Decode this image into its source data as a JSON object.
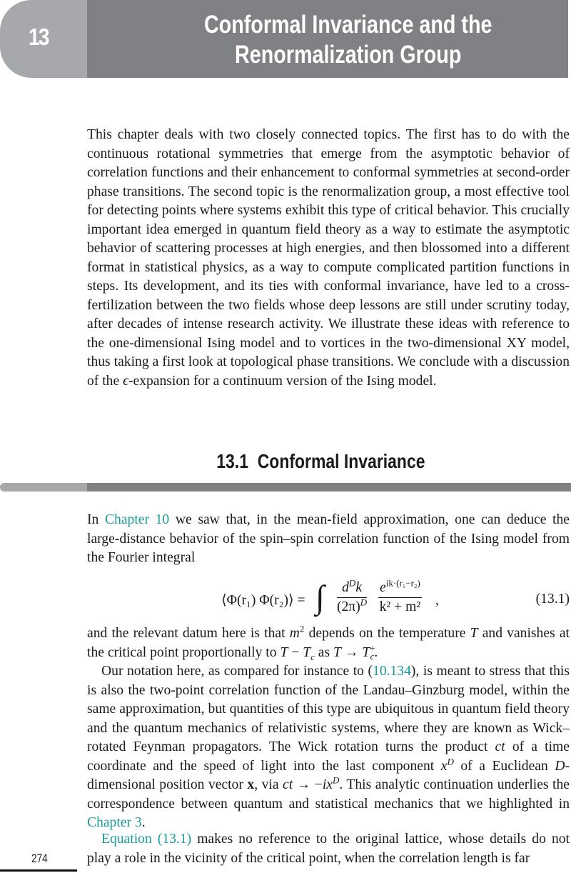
{
  "chapter": {
    "number": "13",
    "title_line1": "Conformal Invariance and the",
    "title_line2": "Renormalization Group"
  },
  "intro": {
    "text": "This chapter deals with two closely connected topics. The first has to do with the continuous rotational symmetries that emerge from the asymptotic behavior of correlation functions and their enhancement to conformal symmetries at second-order phase transitions. The second topic is the renormalization group, a most effective tool for detecting points where systems exhibit this type of critical behavior. This crucially important idea emerged in quantum field theory as a way to estimate the asymptotic behavior of scattering processes at high energies, and then blossomed into a different format in statistical physics, as a way to compute complicated partition functions in steps. Its development, and its ties with conformal invariance, have led to a cross-fertilization between the two fields whose deep lessons are still under scrutiny today, after decades of intense research activity. We illustrate these ideas with reference to the one-dimensional Ising model and to vortices in the two-dimensional XY model, thus taking a first look at topological phase transitions. We conclude with a discussion of the ",
    "epsilon": "ϵ",
    "text_end": "-expansion for a continuum version of the Ising model."
  },
  "section": {
    "number": "13.1",
    "title": "Conformal Invariance"
  },
  "para1": {
    "pre": "In ",
    "link": "Chapter 10",
    "post": " we saw that, in the mean-field approximation, one can deduce the large-distance behavior of the spin–spin correlation function of the Ising model from the Fourier integral"
  },
  "equation": {
    "lhs": "⟨Φ(r₁) Φ(r₂)⟩ =",
    "integral": "∫",
    "frac1_num_d": "d",
    "frac1_num_sup": "D",
    "frac1_num_k": "k",
    "frac1_den": "(2π)",
    "frac1_den_sup": "D",
    "frac2_num_e": "e",
    "frac2_num_sup": "ik·(r₁−r₂)",
    "frac2_den": "k² + m²",
    "comma": ",",
    "number": "(13.1)"
  },
  "para2": {
    "t1": "and the relevant datum here is that ",
    "m": "m",
    "m_sup": "2",
    "t2": " depends on the temperature ",
    "T": "T",
    "t3": " and vanishes at the critical point proportionally to ",
    "T2": "T",
    "minus": " − ",
    "Tc": "T",
    "c": "c",
    "as": " as ",
    "T3": "T",
    "arrow": " → ",
    "Tc2": "T",
    "c2": "c",
    "plus": "+",
    "end": "."
  },
  "para3": {
    "t1": "Our notation here, as compared for instance to (",
    "link": "10.134",
    "t2": "), is meant to stress that this is also the two-point correlation function of the Landau–Ginzburg model, within the same approximation, but quantities of this type are ubiquitous in quantum field theory and the quantum mechanics of relativistic systems, where they are known as Wick–rotated Feynman propagators. The Wick rotation turns the product ",
    "ct": "ct",
    "t3": " of a time coordinate and the speed of light into the last component ",
    "x": "x",
    "xsup": "D",
    "t4": " of a Euclidean ",
    "D": "D",
    "t5": "-dimensional position vector ",
    "xvec": "x",
    "t6": ", via ",
    "ct2": "ct",
    "arrow": " → −",
    "ix": "ix",
    "ixsup": "D",
    "t7": ". This analytic continuation underlies the correspondence between quantum and statistical mechanics that we highlighted in ",
    "link2": "Chapter 3",
    "t8": "."
  },
  "para4": {
    "link": "Equation (13.1)",
    "text": " makes no reference to the original lattice, whose details do not play a role in the vicinity of the critical point, when the correlation length is far"
  },
  "page_number": "274",
  "colors": {
    "header_dark": "#808185",
    "header_light": "#a7a8ac",
    "link": "#1b9a9a"
  }
}
